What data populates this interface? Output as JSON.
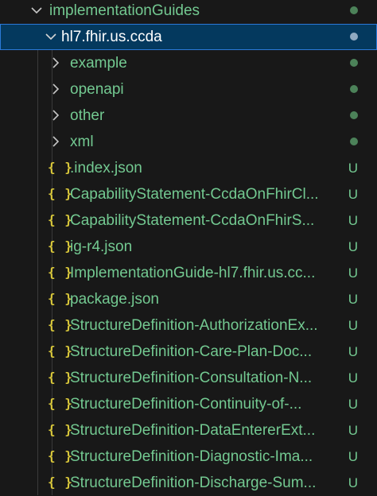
{
  "explorer": {
    "root_folder": {
      "label": "implementationGuides",
      "status": "dot"
    },
    "selected_folder": {
      "label": "hl7.fhir.us.ccda",
      "status": "dot"
    },
    "subfolders": [
      {
        "label": "example",
        "status": "dot"
      },
      {
        "label": "openapi",
        "status": "dot"
      },
      {
        "label": "other",
        "status": "dot"
      },
      {
        "label": "xml",
        "status": "dot"
      }
    ],
    "files": [
      {
        "icon": "{ }",
        "label": ".index.json",
        "status": "U"
      },
      {
        "icon": "{ }",
        "label": "CapabilityStatement-CcdaOnFhirCl...",
        "status": "U"
      },
      {
        "icon": "{ }",
        "label": "CapabilityStatement-CcdaOnFhirS...",
        "status": "U"
      },
      {
        "icon": "{ }",
        "label": "ig-r4.json",
        "status": "U"
      },
      {
        "icon": "{ }",
        "label": "ImplementationGuide-hl7.fhir.us.cc...",
        "status": "U"
      },
      {
        "icon": "{ }",
        "label": "package.json",
        "status": "U"
      },
      {
        "icon": "{ }",
        "label": "StructureDefinition-AuthorizationEx...",
        "status": "U"
      },
      {
        "icon": "{ }",
        "label": "StructureDefinition-Care-Plan-Doc...",
        "status": "U"
      },
      {
        "icon": "{ }",
        "label": "StructureDefinition-Consultation-N...",
        "status": "U"
      },
      {
        "icon": "{ }",
        "label": "StructureDefinition-Continuity-of-...",
        "status": "U"
      },
      {
        "icon": "{ }",
        "label": "StructureDefinition-DataEntererExt...",
        "status": "U"
      },
      {
        "icon": "{ }",
        "label": "StructureDefinition-Diagnostic-Ima...",
        "status": "U"
      },
      {
        "icon": "{ }",
        "label": "StructureDefinition-Discharge-Sum...",
        "status": "U"
      }
    ]
  },
  "colors": {
    "background": "#181818",
    "selection_background": "#04395e",
    "selection_border": "#2b79d8",
    "untracked_green": "#73c991",
    "json_icon_yellow": "#d7c63a"
  },
  "icons": {
    "folder_open": "chevron-down-icon",
    "folder_closed": "chevron-right-icon",
    "json_file": "json-file-icon",
    "modified_indicator": "dot-badge-icon"
  }
}
